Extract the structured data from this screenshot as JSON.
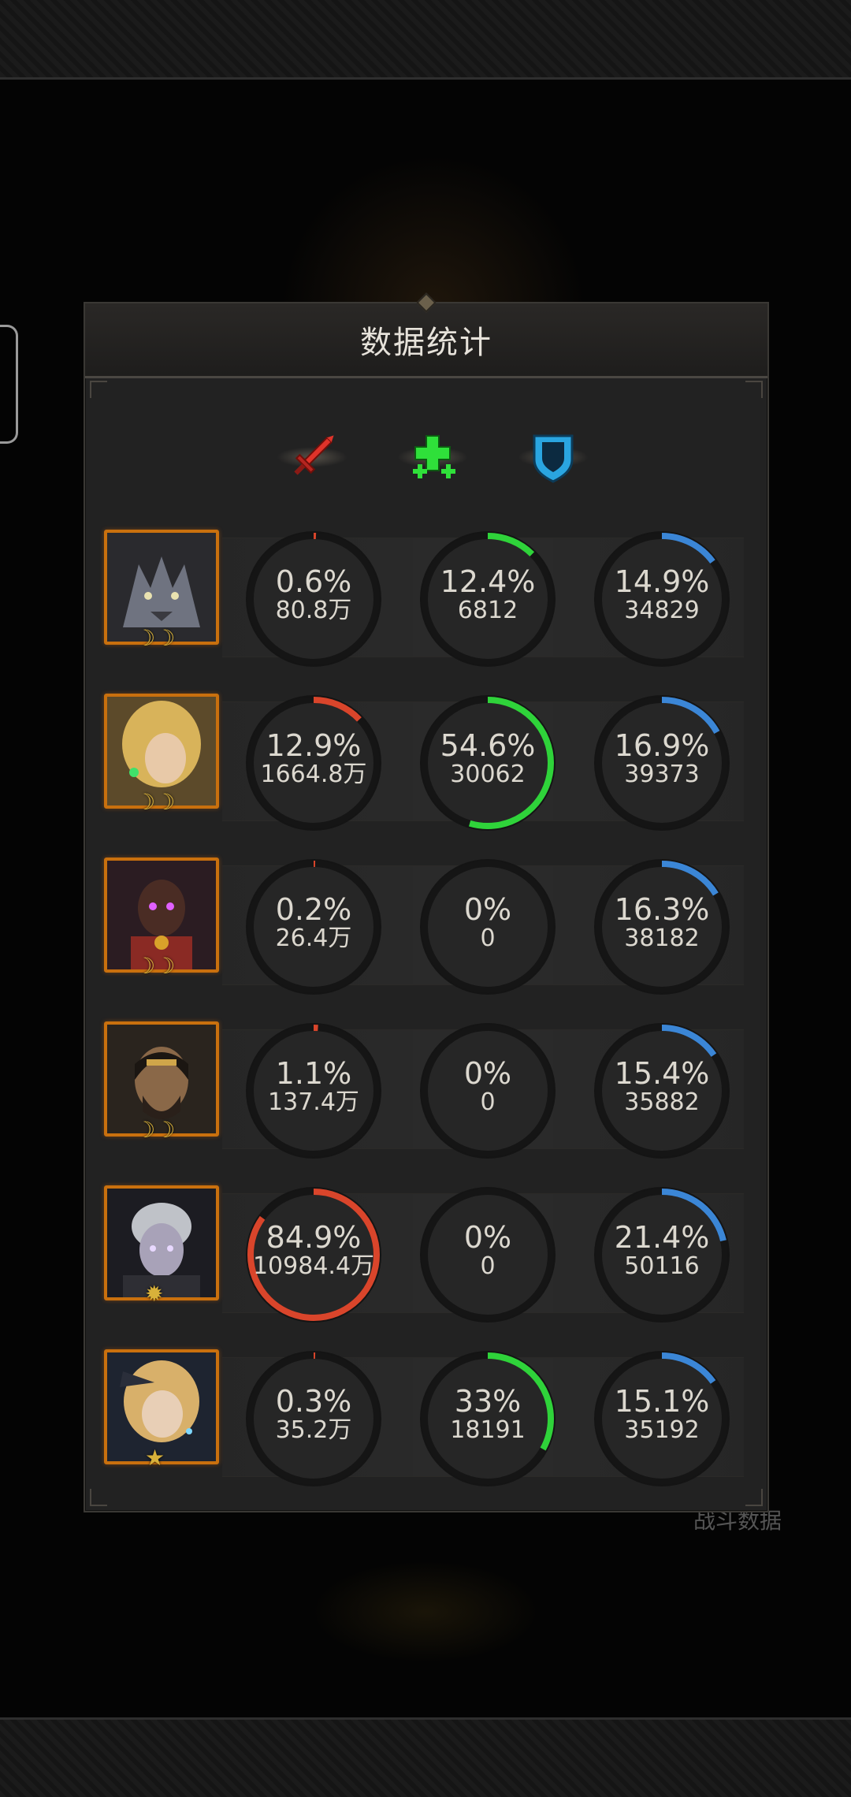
{
  "title": "数据统计",
  "background_label": "战斗数据",
  "colors": {
    "damage": "#d9452b",
    "heal": "#2fd33a",
    "tank": "#3b86d6",
    "frame": "#c9700e"
  },
  "columns": [
    {
      "icon": "sword-icon"
    },
    {
      "icon": "heal-cross-icon"
    },
    {
      "icon": "shield-icon"
    }
  ],
  "heroes": [
    {
      "portrait": "wolf-hero-portrait",
      "badge": "crescent-moons",
      "damage": {
        "pct": "0.6%",
        "value": "80.8万",
        "fraction": 0.006
      },
      "heal": {
        "pct": "12.4%",
        "value": "6812",
        "fraction": 0.124
      },
      "tank": {
        "pct": "14.9%",
        "value": "34829",
        "fraction": 0.149
      }
    },
    {
      "portrait": "elf-mage-portrait",
      "badge": "crescent-moons",
      "damage": {
        "pct": "12.9%",
        "value": "1664.8万",
        "fraction": 0.129
      },
      "heal": {
        "pct": "54.6%",
        "value": "30062",
        "fraction": 0.546
      },
      "tank": {
        "pct": "16.9%",
        "value": "39373",
        "fraction": 0.169
      }
    },
    {
      "portrait": "dark-sorcerer-portrait",
      "badge": "crescent-moons",
      "damage": {
        "pct": "0.2%",
        "value": "26.4万",
        "fraction": 0.002
      },
      "heal": {
        "pct": "0%",
        "value": "0",
        "fraction": 0
      },
      "tank": {
        "pct": "16.3%",
        "value": "38182",
        "fraction": 0.163
      }
    },
    {
      "portrait": "bearded-warrior-portrait",
      "badge": "crescent-moons",
      "damage": {
        "pct": "1.1%",
        "value": "137.4万",
        "fraction": 0.011
      },
      "heal": {
        "pct": "0%",
        "value": "0",
        "fraction": 0
      },
      "tank": {
        "pct": "15.4%",
        "value": "35882",
        "fraction": 0.154
      }
    },
    {
      "portrait": "pale-youth-portrait",
      "badge": "sun",
      "damage": {
        "pct": "84.9%",
        "value": "10984.4万",
        "fraction": 0.849
      },
      "heal": {
        "pct": "0%",
        "value": "0",
        "fraction": 0
      },
      "tank": {
        "pct": "21.4%",
        "value": "50116",
        "fraction": 0.214
      }
    },
    {
      "portrait": "blonde-mage-portrait",
      "badge": "star",
      "damage": {
        "pct": "0.3%",
        "value": "35.2万",
        "fraction": 0.003
      },
      "heal": {
        "pct": "33%",
        "value": "18191",
        "fraction": 0.33
      },
      "tank": {
        "pct": "15.1%",
        "value": "35192",
        "fraction": 0.151
      }
    }
  ]
}
